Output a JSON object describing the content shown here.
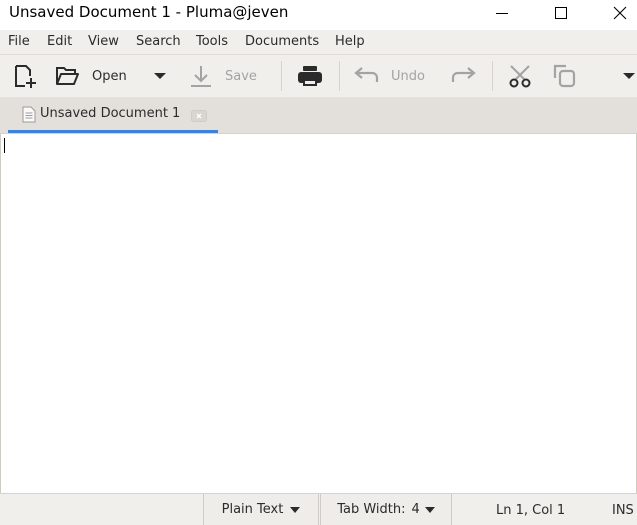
{
  "window": {
    "title": "Unsaved Document 1 - Pluma@jeven",
    "controls": [
      "minimize-icon",
      "maximize-icon",
      "close-icon"
    ]
  },
  "menu": {
    "items": [
      "File",
      "Edit",
      "View",
      "Search",
      "Tools",
      "Documents",
      "Help"
    ]
  },
  "toolbar": {
    "open_label": "Open",
    "save_label": "Save",
    "undo_label": "Undo",
    "icons": [
      "new-document-icon",
      "open-folder-icon",
      "dropdown-icon",
      "save-icon",
      "print-icon",
      "undo-icon",
      "redo-icon",
      "cut-icon",
      "copy-icon",
      "overflow-icon"
    ]
  },
  "tabs": [
    {
      "label": "Unsaved Document 1",
      "active": true
    }
  ],
  "editor": {
    "content": ""
  },
  "statusbar": {
    "language": "Plain Text",
    "tab_width_label": "Tab Width:",
    "tab_width_value": "4",
    "position": "Ln 1, Col 1",
    "mode": "INS"
  },
  "colors": {
    "accent": "#3c82d6",
    "chrome": "#f1efec",
    "tabbar": "#e3e0db"
  }
}
